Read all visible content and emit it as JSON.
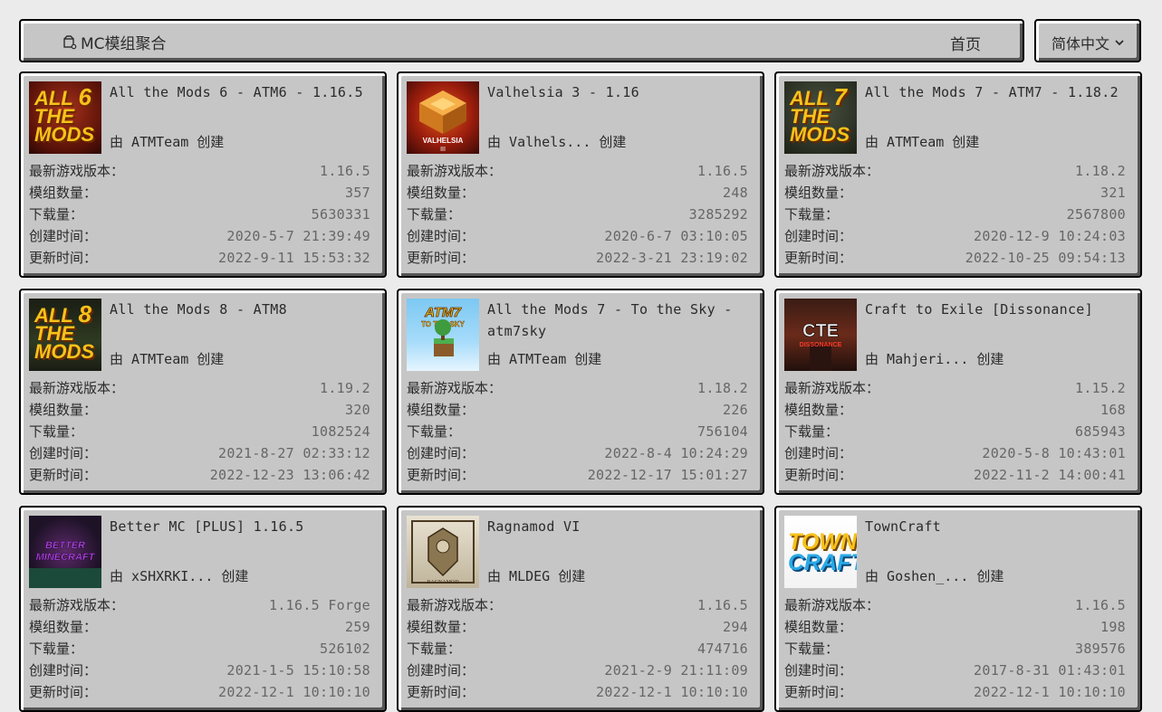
{
  "header": {
    "brand": "MC模组聚合",
    "home": "首页",
    "language": "简体中文"
  },
  "labels": {
    "version": "最新游戏版本：",
    "mods": "模组数量：",
    "downloads": "下载量：",
    "created": "创建时间：",
    "updated": "更新时间："
  },
  "cards": [
    {
      "title": "All the Mods 6 - ATM6 - 1.16.5",
      "author": "ATMTeam",
      "version": "1.16.5",
      "mods": "357",
      "downloads": "5630331",
      "created": "2020-5-7 21:39:49",
      "updated": "2022-9-11 15:53:32",
      "thumb_text": [
        "ALL",
        "THE",
        "MODS"
      ],
      "thumb_num": "6"
    },
    {
      "title": "Valhelsia 3 - 1.16",
      "author": "Valhels...",
      "version": "1.16.5",
      "mods": "248",
      "downloads": "3285292",
      "created": "2020-6-7 03:10:05",
      "updated": "2022-3-21 23:19:02",
      "thumb_text": [
        "VALHELSIA",
        "III"
      ]
    },
    {
      "title": "All the Mods 7 - ATM7 - 1.18.2",
      "author": "ATMTeam",
      "version": "1.18.2",
      "mods": "321",
      "downloads": "2567800",
      "created": "2020-12-9 10:24:03",
      "updated": "2022-10-25 09:54:13",
      "thumb_text": [
        "ALL",
        "THE",
        "MODS"
      ],
      "thumb_num": "7"
    },
    {
      "title": "All the Mods 8 - ATM8",
      "author": "ATMTeam",
      "version": "1.19.2",
      "mods": "320",
      "downloads": "1082524",
      "created": "2021-8-27 02:33:12",
      "updated": "2022-12-23 13:06:42",
      "thumb_text": [
        "ALL",
        "THE",
        "MODS"
      ],
      "thumb_num": "8"
    },
    {
      "title": "All the Mods 7 - To the Sky - atm7sky",
      "author": "ATMTeam",
      "version": "1.18.2",
      "mods": "226",
      "downloads": "756104",
      "created": "2022-8-4 10:24:29",
      "updated": "2022-12-17 15:01:27",
      "thumb_text": [
        "ATM7",
        "TO THE SKY"
      ]
    },
    {
      "title": "Craft to Exile [Dissonance]",
      "author": "Mahjeri...",
      "version": "1.15.2",
      "mods": "168",
      "downloads": "685943",
      "created": "2020-5-8 10:43:01",
      "updated": "2022-11-2 14:00:41",
      "thumb_text": [
        "CTE",
        "DISSONANCE"
      ]
    },
    {
      "title": "Better MC [PLUS] 1.16.5",
      "author": "xSHXRKI...",
      "version": "1.16.5 Forge",
      "mods": "259",
      "downloads": "526102",
      "created": "2021-1-5 15:10:58",
      "updated": "2022-12-1 10:10:10",
      "thumb_text": [
        "BETTER",
        "MINECRAFT"
      ]
    },
    {
      "title": "Ragnamod VI",
      "author": "MLDEG",
      "version": "1.16.5",
      "mods": "294",
      "downloads": "474716",
      "created": "2021-2-9 21:11:09",
      "updated": "2022-12-1 10:10:10",
      "thumb_text": [
        "RAGNAMOD"
      ]
    },
    {
      "title": "TownCraft",
      "author": "Goshen_...",
      "version": "1.16.5",
      "mods": "198",
      "downloads": "389576",
      "created": "2017-8-31 01:43:01",
      "updated": "2022-12-1 10:10:10",
      "thumb_text": [
        "TOWN",
        "CRAFT"
      ]
    }
  ],
  "created_by": "创建",
  "by_prefix": "由"
}
